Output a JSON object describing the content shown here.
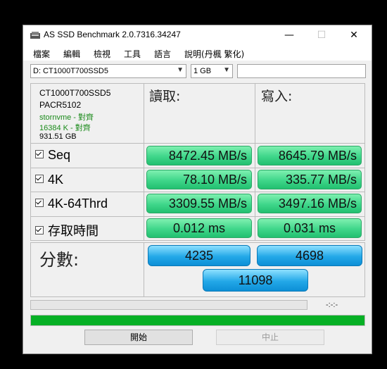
{
  "window": {
    "title": "AS SSD Benchmark 2.0.7316.34247",
    "min_glyph": "—",
    "max_glyph": "☐",
    "close_glyph": "✕"
  },
  "menu": [
    "檔案",
    "編輯",
    "檢視",
    "工具",
    "語言",
    "說明(丹楓 繁化)"
  ],
  "toolbar": {
    "drive_value": "D: CT1000T700SSD5",
    "size_value": "1 GB",
    "text_field_value": ""
  },
  "drive_info": {
    "model": "CT1000T700SSD5",
    "firmware": "PACR5102",
    "driver": "stornvme - 對齊",
    "alignment": "16384 K - 對齊",
    "capacity": "931.51 GB"
  },
  "headers": {
    "read": "讀取:",
    "write": "寫入:"
  },
  "rows": [
    {
      "label": "Seq",
      "read": "8472.45 MB/s",
      "write": "8645.79 MB/s"
    },
    {
      "label": "4K",
      "read": "78.10 MB/s",
      "write": "335.77 MB/s"
    },
    {
      "label": "4K-64Thrd",
      "read": "3309.55 MB/s",
      "write": "3497.16 MB/s"
    },
    {
      "label": "存取時間",
      "read": "0.012 ms",
      "write": "0.031 ms"
    }
  ],
  "score": {
    "label": "分數:",
    "read": "4235",
    "write": "4698",
    "total": "11098"
  },
  "status": {
    "time": "-:-:-",
    "progress_top": 0,
    "progress_bottom": 1.0
  },
  "buttons": {
    "start": "開始",
    "stop": "中止"
  },
  "colors": {
    "result_green": "#3fd68a",
    "score_blue": "#23a8e8",
    "progress_green": "#06b025",
    "info_green": "#1a8a1a"
  }
}
